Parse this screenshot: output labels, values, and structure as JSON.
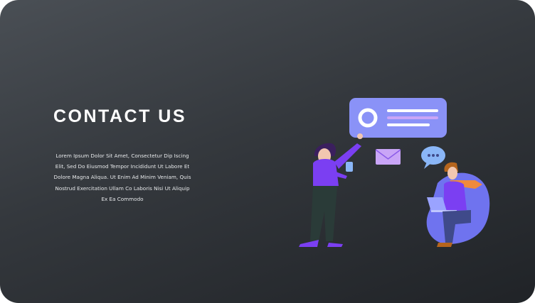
{
  "heading": "CONTACT US",
  "description": "Lorem Ipsum Dolor Sit Amet, Consectetur Dip Iscing Elit, Sed Do Eiusmod Tempor Incididunt Ut Labore Et Dolore Magna Aliqua. Ut Enim Ad Minim Veniam, Quis Nostrud Exercitation Ullam Co Laboris Nisi Ut Aliquip Ex Ea Commodo",
  "colors": {
    "background_dark": "#202327",
    "background_light": "#4a4f55",
    "accent_purple": "#7b3ff2",
    "accent_blue": "#8a92f7",
    "accent_orange": "#f08a3c"
  },
  "illustration": {
    "icons": [
      "chat-card-icon",
      "envelope-icon",
      "speech-bubble-icon",
      "phone-icon",
      "laptop-icon"
    ]
  }
}
